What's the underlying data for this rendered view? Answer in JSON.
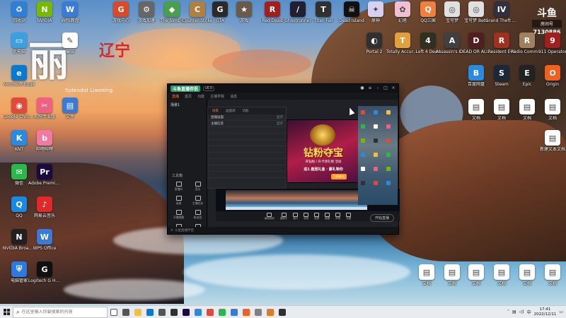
{
  "desktop": {
    "icons": [
      {
        "label": "回收站",
        "color": "#2f7fd6",
        "glyph": "♻"
      },
      {
        "label": "NVIDIA",
        "color": "#76b900",
        "glyph": "N"
      },
      {
        "label": "WPS网盘",
        "color": "#3a7bd5",
        "glyph": "W"
      },
      {
        "label": "游戏中心",
        "color": "#d84a2a",
        "glyph": "G"
      },
      {
        "label": "游戏加速",
        "color": "#666666",
        "glyph": "⚙"
      },
      {
        "label": "The Sims 4",
        "color": "#4aa04a",
        "glyph": "◆"
      },
      {
        "label": "Counter-Strike",
        "color": "#b08040",
        "glyph": "C"
      },
      {
        "label": "GTA",
        "color": "#2a2a2a",
        "glyph": "G"
      },
      {
        "label": "游戏",
        "color": "#6a5a4a",
        "glyph": "★"
      },
      {
        "label": "Red Dead",
        "color": "#a02020",
        "glyph": "R"
      },
      {
        "label": "Ghostrunner",
        "color": "#202030",
        "glyph": "/"
      },
      {
        "label": "Titan Fall",
        "color": "#303030",
        "glyph": "T"
      },
      {
        "label": "Dead Island",
        "color": "#101010",
        "glyph": "☠"
      },
      {
        "label": "原神",
        "color": "#d8d0f0",
        "glyph": "✦"
      },
      {
        "label": "幻塔",
        "color": "#f0c0d0",
        "glyph": "✿"
      },
      {
        "label": "QQ三国",
        "color": "#f08040",
        "glyph": "Q"
      },
      {
        "label": "宝可梦",
        "color": "#e0e0e0",
        "glyph": "◎"
      },
      {
        "label": "宝可梦 Beta",
        "color": "#e0e0e0",
        "glyph": "◎"
      },
      {
        "label": "Grand Theft Auto IV",
        "color": "#303040",
        "glyph": "IV"
      },
      {
        "label": "此电脑",
        "color": "#3aa0e0",
        "glyph": "▭"
      },
      {
        "label": "编辑",
        "color": "#ffffff",
        "glyph": "✎"
      },
      {
        "label": "Portal 2",
        "color": "#303030",
        "glyph": "◐"
      },
      {
        "label": "Totally Accurate",
        "color": "#e0a040",
        "glyph": "T"
      },
      {
        "label": "Left 4 Dead",
        "color": "#303020",
        "glyph": "4"
      },
      {
        "label": "Assassin's Creed",
        "color": "#404040",
        "glyph": "A"
      },
      {
        "label": "DEAD OR ALIVE",
        "color": "#502020",
        "glyph": "D"
      },
      {
        "label": "Resident Evil",
        "color": "#a03020",
        "glyph": "R"
      },
      {
        "label": "Radio Commander",
        "color": "#a08060",
        "glyph": "R"
      },
      {
        "label": "911 Operator",
        "color": "#a02020",
        "glyph": "9"
      },
      {
        "label": "Microsoft Edge",
        "color": "#0a7ad0",
        "glyph": "e"
      },
      {
        "label": "百度网盘",
        "color": "#2a8ae0",
        "glyph": "B"
      },
      {
        "label": "Steam",
        "color": "#1b2838",
        "glyph": "S"
      },
      {
        "label": "Epic",
        "color": "#222222",
        "glyph": "E"
      },
      {
        "label": "Origin",
        "color": "#f06020",
        "glyph": "O"
      },
      {
        "label": "Google Chrome",
        "color": "#e04a3a",
        "glyph": "◉"
      },
      {
        "label": "剪映专业版",
        "color": "#f06080",
        "glyph": "✂"
      },
      {
        "label": "文件",
        "color": "#3a7ad5",
        "glyph": "▤"
      },
      {
        "label": "KNT",
        "color": "#2a8ae0",
        "glyph": "K"
      },
      {
        "label": "哔哩哔哩",
        "color": "#f07aa0",
        "glyph": "b"
      },
      {
        "label": "微信",
        "color": "#2ab84a",
        "glyph": "✉"
      },
      {
        "label": "Adobe Premiere Pro",
        "color": "#1a0a40",
        "glyph": "Pr"
      },
      {
        "label": "QQ",
        "color": "#1a8ae0",
        "glyph": "Q"
      },
      {
        "label": "网易云音乐",
        "color": "#e02a2a",
        "glyph": "♪"
      },
      {
        "label": "NVIDIA Broadcast",
        "color": "#202020",
        "glyph": "N"
      },
      {
        "label": "WPS Office",
        "color": "#3a7ad5",
        "glyph": "W"
      },
      {
        "label": "电脑管家",
        "color": "#2a7ae0",
        "glyph": "⛨"
      },
      {
        "label": "Logitech G HUB",
        "color": "#101010",
        "glyph": "G"
      },
      {
        "label": "文档",
        "color": "#ffffff",
        "glyph": "▤"
      },
      {
        "label": "文档",
        "color": "#ffffff",
        "glyph": "▤"
      },
      {
        "label": "文档",
        "color": "#ffffff",
        "glyph": "▤"
      },
      {
        "label": "文档",
        "color": "#ffffff",
        "glyph": "▤"
      },
      {
        "label": "新建文本文档",
        "color": "#ffffff",
        "glyph": "▤"
      },
      {
        "label": "文档",
        "color": "#ffffff",
        "glyph": "▤"
      },
      {
        "label": "文档",
        "color": "#ffffff",
        "glyph": "▤"
      },
      {
        "label": "文档",
        "color": "#ffffff",
        "glyph": "▤"
      },
      {
        "label": "文档",
        "color": "#ffffff",
        "glyph": "▤"
      },
      {
        "label": "文档",
        "color": "#ffffff",
        "glyph": "▤"
      },
      {
        "label": "文档",
        "color": "#ffffff",
        "glyph": "▤"
      }
    ],
    "calligraphy": {
      "big": "丽",
      "seal": "辽宁",
      "sub": "Splendid Liaoning"
    },
    "corner_logo": {
      "mark": "斗鱼",
      "name": "房间号",
      "number": "7130886"
    }
  },
  "app": {
    "logo": "斗鱼直播伴侣",
    "version": "v6.0",
    "tabs": [
      "直播",
      "首页",
      "功能",
      "主播学院",
      "消息"
    ],
    "scene_header": "场景1",
    "tools_label": "工具箱",
    "tools": [
      "直播间",
      "音乐",
      "录屏",
      "主播任务",
      "开播提醒",
      "粉丝团",
      "特效",
      "更多"
    ],
    "panel_tabs": [
      "场景",
      "画面源",
      "功能"
    ],
    "panel_rows": [
      {
        "label": "直播画面",
        "right": "显示"
      },
      {
        "label": "主播信息",
        "right": "显示"
      }
    ],
    "ad": {
      "headline": "钻粉夺宝",
      "sub": "开钻粉 / 升卡领礼物 活动",
      "line2": "进1 鹿居礼盒 · 豪礼等你",
      "button": "立即参与"
    },
    "controls": [
      "画面录制",
      "摄像头",
      "窗口",
      "游戏",
      "投屏",
      "截图",
      "声音",
      "设置"
    ],
    "start_live": "开始直播",
    "footer": "© 斗鱼直播伴侣"
  },
  "taskbar": {
    "search_placeholder": "在这里输入你要搜索的内容",
    "apps": [
      {
        "name": "cortana",
        "color": "#ffffff"
      },
      {
        "name": "task-view",
        "color": "#555555"
      },
      {
        "name": "file-explorer",
        "color": "#f0c040"
      },
      {
        "name": "edge",
        "color": "#0a7ad0"
      },
      {
        "name": "settings",
        "color": "#555555"
      },
      {
        "name": "app",
        "color": "#303030"
      },
      {
        "name": "premiere",
        "color": "#1a0a40"
      },
      {
        "name": "app2",
        "color": "#2a8ae0"
      },
      {
        "name": "chrome",
        "color": "#e04a3a"
      },
      {
        "name": "wechat",
        "color": "#2ab84a"
      },
      {
        "name": "app3",
        "color": "#3a7ad5"
      },
      {
        "name": "app4",
        "color": "#f06020"
      },
      {
        "name": "app5",
        "color": "#808080"
      },
      {
        "name": "app6",
        "color": "#e07a20"
      },
      {
        "name": "app7",
        "color": "#303030"
      }
    ],
    "tray_lang": "中",
    "time": "17:41",
    "date": "2022/12/11"
  }
}
